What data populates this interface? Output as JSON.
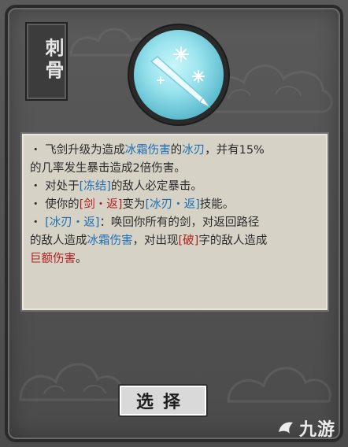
{
  "card": {
    "title": "刺骨",
    "description": [
      {
        "segments": [
          {
            "text": "・ 飞剑升级为造成",
            "kind": "plain"
          },
          {
            "text": "冰霜伤害",
            "kind": "ice"
          },
          {
            "text": "的",
            "kind": "plain"
          },
          {
            "text": "冰刃",
            "kind": "ice"
          },
          {
            "text": "，并有15%",
            "kind": "plain"
          }
        ]
      },
      {
        "segments": [
          {
            "text": "的几率发生暴击造成2倍伤害。",
            "kind": "plain"
          }
        ]
      },
      {
        "segments": [
          {
            "text": "・ 对处于",
            "kind": "plain"
          },
          {
            "text": "[冻结]",
            "kind": "ice"
          },
          {
            "text": "的敌人必定暴击。",
            "kind": "plain"
          }
        ]
      },
      {
        "segments": [
          {
            "text": "・ 使你的",
            "kind": "plain"
          },
          {
            "text": "[剑・返]",
            "kind": "red"
          },
          {
            "text": "变为",
            "kind": "plain"
          },
          {
            "text": "[冰刃・返]",
            "kind": "ice"
          },
          {
            "text": "技能。",
            "kind": "plain"
          }
        ]
      },
      {
        "segments": [
          {
            "text": "・ ",
            "kind": "plain"
          },
          {
            "text": "[冰刃・返]",
            "kind": "ice"
          },
          {
            "text": "：唤回你所有的剑，对返回路径",
            "kind": "plain"
          }
        ]
      },
      {
        "segments": [
          {
            "text": "的敌人造成",
            "kind": "plain"
          },
          {
            "text": "冰霜伤害",
            "kind": "ice"
          },
          {
            "text": "，对出现",
            "kind": "plain"
          },
          {
            "text": "[破]",
            "kind": "red"
          },
          {
            "text": "字的敌人造成",
            "kind": "plain"
          }
        ]
      },
      {
        "segments": [
          {
            "text": "巨额伤害",
            "kind": "red"
          },
          {
            "text": "。",
            "kind": "plain"
          }
        ]
      }
    ],
    "button_label": "选择"
  },
  "watermark": {
    "text": "九游"
  },
  "colors": {
    "ice": "#1f6fb6",
    "red": "#b21f1f",
    "panel": "#d6d2c6"
  }
}
